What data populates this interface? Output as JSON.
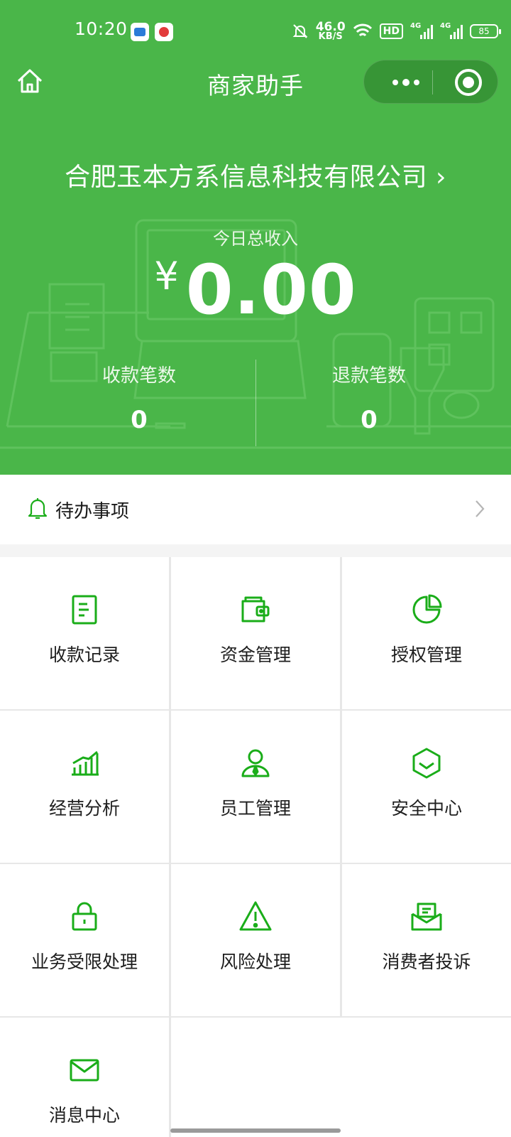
{
  "status_bar": {
    "time": "10:20",
    "net_speed_value": "46.0",
    "net_speed_unit": "KB/S",
    "hd_label": "HD",
    "signal1_label": "4G",
    "signal2_label": "4G",
    "battery": "85",
    "icons": [
      "mute-icon",
      "wifi-icon",
      "signal-icon",
      "battery-icon"
    ]
  },
  "nav": {
    "title": "商家助手",
    "home_icon": "home-icon",
    "more_icon": "more-dots-icon",
    "close_icon": "target-close-icon"
  },
  "header": {
    "company": "合肥玉本方系信息科技有限公司",
    "chevron": "›",
    "income_label": "今日总收入",
    "currency": "¥",
    "income_value": "0.00",
    "stats": [
      {
        "label": "收款笔数",
        "value": "0"
      },
      {
        "label": "退款笔数",
        "value": "0"
      }
    ]
  },
  "todo": {
    "label": "待办事项",
    "icon": "bell-icon",
    "arrow_icon": "chevron-right-icon"
  },
  "menu": {
    "accent_color": "#1aad19",
    "items": [
      {
        "label": "收款记录",
        "icon": "receipt-icon"
      },
      {
        "label": "资金管理",
        "icon": "wallet-icon"
      },
      {
        "label": "授权管理",
        "icon": "pie-chart-icon"
      },
      {
        "label": "经营分析",
        "icon": "bar-chart-icon"
      },
      {
        "label": "员工管理",
        "icon": "employee-icon"
      },
      {
        "label": "安全中心",
        "icon": "shield-icon"
      },
      {
        "label": "业务受限处理",
        "icon": "lock-icon"
      },
      {
        "label": "风险处理",
        "icon": "warning-icon"
      },
      {
        "label": "消费者投诉",
        "icon": "complaint-icon"
      },
      {
        "label": "消息中心",
        "icon": "mail-icon"
      }
    ]
  }
}
